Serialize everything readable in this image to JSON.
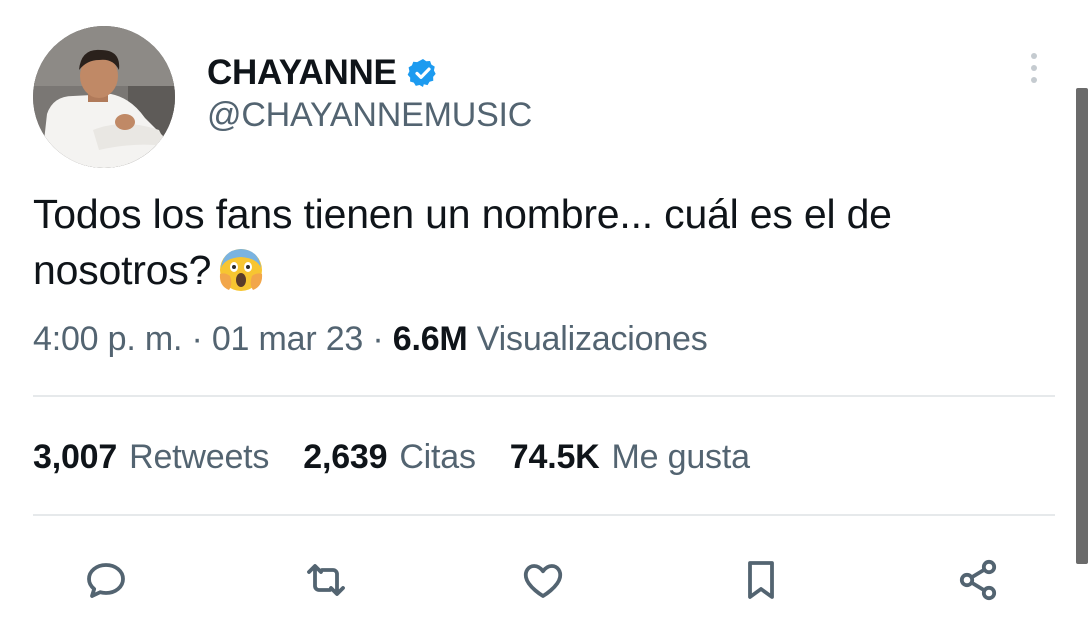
{
  "tweet": {
    "author": {
      "display_name": "CHAYANNE",
      "handle": "@CHAYANNEMUSIC",
      "verified": true,
      "verified_color": "#1d9bf0"
    },
    "text": "Todos los fans tienen un nombre... cuál es el de nosotros?",
    "emoji": "face-screaming-in-fear-icon",
    "time": "4:00 p. m.",
    "separator": "·",
    "date": "01 mar 23",
    "views_count": "6.6M",
    "views_label": "Visualizaciones",
    "stats": {
      "retweets_count": "3,007",
      "retweets_label": "Retweets",
      "quotes_count": "2,639",
      "quotes_label": "Citas",
      "likes_count": "74.5K",
      "likes_label": "Me gusta"
    }
  },
  "actions": [
    "reply-icon",
    "retweet-icon",
    "like-icon",
    "bookmark-icon",
    "share-icon"
  ],
  "colors": {
    "text_primary": "#0f1419",
    "text_secondary": "#536471",
    "divider": "#e6e9eb",
    "icon": "#536471"
  }
}
